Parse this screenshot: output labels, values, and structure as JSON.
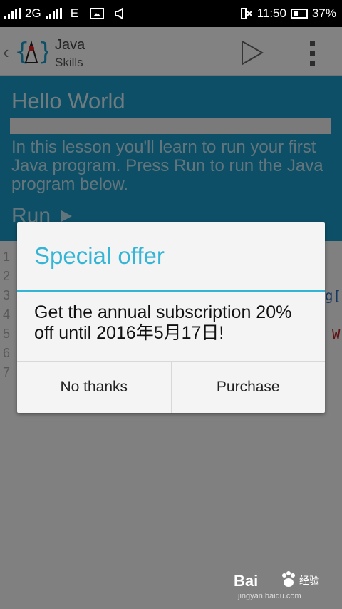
{
  "status_bar": {
    "network": "2G",
    "network2": "E",
    "time": "11:50",
    "battery": "37%"
  },
  "app_bar": {
    "title": "Java",
    "subtitle": "Skills"
  },
  "lesson": {
    "title": "Hello World",
    "description": "In this lesson you'll learn to run your first Java program. Press Run to run the Java program below.",
    "run_label": "Run"
  },
  "code": {
    "line_numbers": [
      "1",
      "2",
      "3",
      "4",
      "5",
      "6",
      "7"
    ],
    "line3_fragment": "g[",
    "line5_fragment": "W"
  },
  "dialog": {
    "title": "Special offer",
    "message": "Get the annual subscription 20% off until 2016年5月17日!",
    "no_button": "No thanks",
    "purchase_button": "Purchase"
  },
  "watermark": {
    "brand": "Bai",
    "cn_text": "经验",
    "url": "jingyan.baidu.com"
  },
  "colors": {
    "hero": "#1a98c4",
    "dialog_accent": "#35b5d6"
  }
}
